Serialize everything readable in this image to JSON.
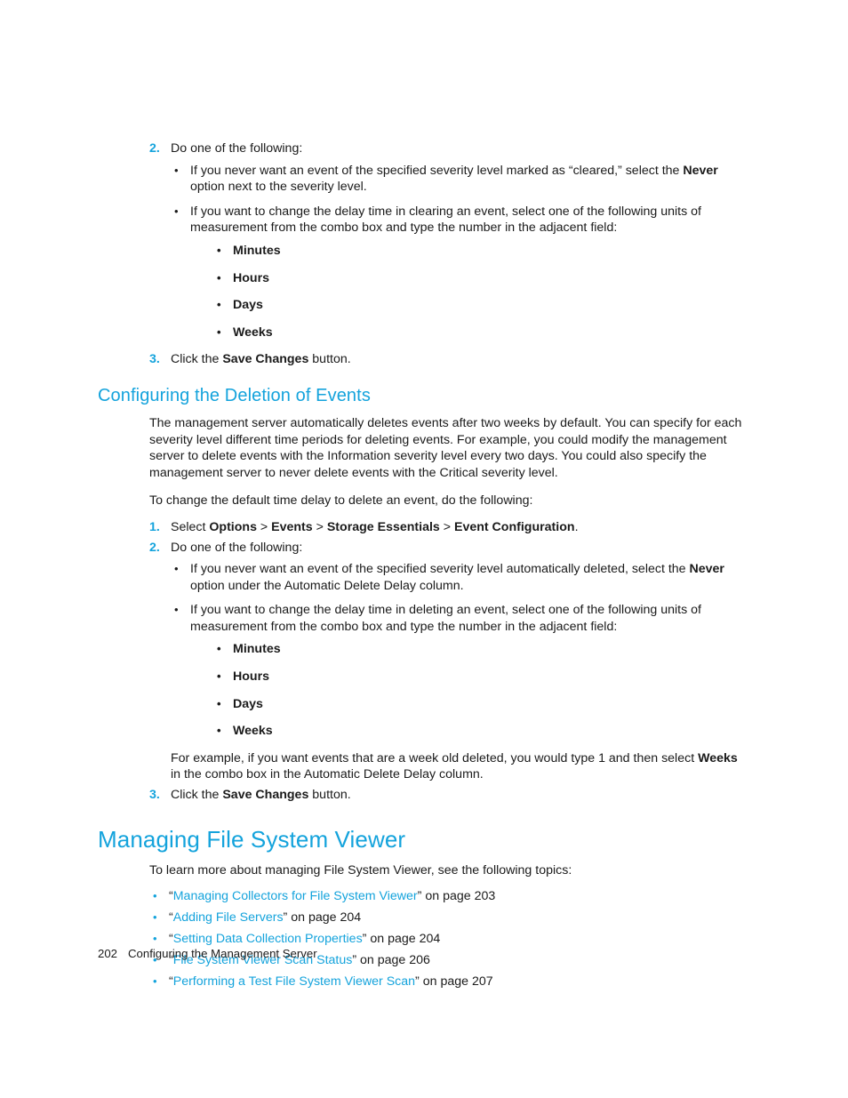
{
  "page": {
    "number": "202",
    "footer_title": "Configuring the Management Server",
    "accent_color": "#14a3dc",
    "text_color": "#1a1a1a",
    "background_color": "#ffffff"
  },
  "top_section": {
    "step2": {
      "marker": "2.",
      "text": "Do one of the following:",
      "bullets": [
        {
          "prefix": "If you never want an event of the specified severity level marked as “cleared,” select the ",
          "bold": "Never",
          "suffix": " option next to the severity level."
        },
        {
          "prefix": "If you want to change the delay time in clearing an event, select one of the following units of measurement from the combo box and type the number in the adjacent field:",
          "bold": "",
          "suffix": ""
        }
      ],
      "units": [
        "Minutes",
        "Hours",
        "Days",
        "Weeks"
      ]
    },
    "step3": {
      "marker": "3.",
      "prefix": "Click the ",
      "bold": "Save Changes",
      "suffix": " button."
    }
  },
  "section_deletion": {
    "heading": "Configuring the Deletion of Events",
    "intro_paragraph": "The management server automatically deletes events after two weeks by default. You can specify for each severity level different time periods for deleting events. For example, you could modify the management server to delete events with the Information severity level every two days. You could also specify the management server to never delete events with the Critical severity level.",
    "lead_in": "To change the default time delay to delete an event, do the following:",
    "step1": {
      "marker": "1.",
      "select_word": "Select ",
      "path": [
        "Options",
        "Events",
        "Storage Essentials",
        "Event Configuration"
      ],
      "separator": " > ",
      "trailing": "."
    },
    "step2": {
      "marker": "2.",
      "text": "Do one of the following:",
      "bullets": [
        {
          "prefix": "If you never want an event of the specified severity level automatically deleted, select the ",
          "bold": "Never",
          "suffix": " option under the Automatic Delete Delay column."
        },
        {
          "prefix": "If you want to change the delay time in deleting an event, select one of the following units of measurement from the combo box and type the number in the adjacent field:",
          "bold": "",
          "suffix": ""
        }
      ],
      "units": [
        "Minutes",
        "Hours",
        "Days",
        "Weeks"
      ],
      "example": {
        "prefix": "For example, if you want events that are a week old deleted, you would type 1 and then select ",
        "bold": "Weeks",
        "suffix": " in the combo box in the Automatic Delete Delay column."
      }
    },
    "step3": {
      "marker": "3.",
      "prefix": "Click the ",
      "bold": "Save Changes",
      "suffix": " button."
    }
  },
  "section_fsv": {
    "heading": "Managing File System Viewer",
    "lead_in": "To learn more about managing File System Viewer, see the following topics:",
    "links": [
      {
        "open_quote": "“",
        "title": "Managing Collectors for File System Viewer",
        "close_quote": "”",
        "page_ref": " on page 203"
      },
      {
        "open_quote": "“",
        "title": "Adding File Servers",
        "close_quote": "”",
        "page_ref": " on page 204"
      },
      {
        "open_quote": "“",
        "title": "Setting Data Collection Properties",
        "close_quote": "”",
        "page_ref": " on page 204"
      },
      {
        "open_quote": "“",
        "title": "File System Viewer Scan Status",
        "close_quote": "”",
        "page_ref": " on page 206"
      },
      {
        "open_quote": "“",
        "title": "Performing a Test File System Viewer Scan",
        "close_quote": "”",
        "page_ref": " on page 207"
      }
    ]
  },
  "icons": {
    "bullet": "•"
  }
}
